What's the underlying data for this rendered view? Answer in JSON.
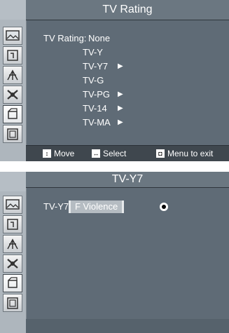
{
  "screen1": {
    "title": "TV Rating",
    "rating_label": "TV Rating:",
    "rating_value": "None",
    "items": [
      {
        "label": "TV-Y",
        "has_submenu": false
      },
      {
        "label": "TV-Y7",
        "has_submenu": true
      },
      {
        "label": "TV-G",
        "has_submenu": false
      },
      {
        "label": "TV-PG",
        "has_submenu": true
      },
      {
        "label": "TV-14",
        "has_submenu": true
      },
      {
        "label": "TV-MA",
        "has_submenu": true
      }
    ],
    "arrow_glyph": "▶",
    "footer": {
      "move": "Move",
      "select": "Select",
      "exit": "Menu to exit"
    }
  },
  "screen2": {
    "title": "TV-Y7",
    "field_label": "TV-Y7:",
    "option": "F Violence",
    "option_selected": true
  },
  "sidebar_icons": [
    "picture-icon",
    "sound-icon",
    "channel-icon",
    "setup-icon",
    "input-icon",
    "guide-icon"
  ],
  "colors": {
    "panel": "#5f6b76",
    "title_bar": "#6b7781",
    "sidebar": "#aeb6bd",
    "footer": "#3f474e",
    "text": "#ffffff"
  }
}
